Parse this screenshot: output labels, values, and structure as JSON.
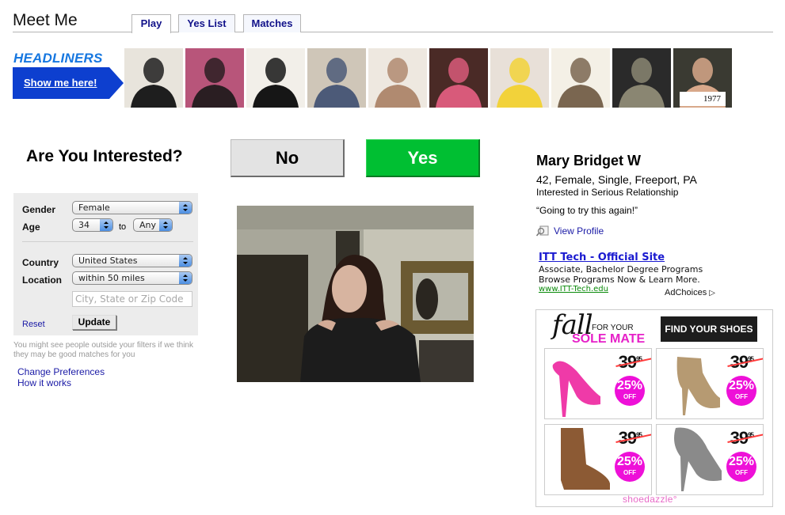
{
  "header": {
    "title": "Meet Me",
    "tabs": [
      {
        "label": "Play",
        "active": true
      },
      {
        "label": "Yes List",
        "active": false
      },
      {
        "label": "Matches",
        "active": false
      }
    ]
  },
  "headliners": {
    "title": "HEADLINERS",
    "button_label": "Show me here!",
    "thumbnails": [
      {
        "name": "headliner-1",
        "colors": [
          "#e8e4dc",
          "#1e1e1e"
        ]
      },
      {
        "name": "headliner-2",
        "colors": [
          "#b8557a",
          "#2a1e22"
        ]
      },
      {
        "name": "headliner-3",
        "colors": [
          "#f2efe9",
          "#161616"
        ]
      },
      {
        "name": "headliner-4",
        "colors": [
          "#cfc6b8",
          "#4c5a78"
        ]
      },
      {
        "name": "headliner-5",
        "colors": [
          "#eee8e0",
          "#b08a70"
        ]
      },
      {
        "name": "headliner-6",
        "colors": [
          "#4a2a26",
          "#d85a7a"
        ]
      },
      {
        "name": "headliner-7",
        "colors": [
          "#e8e0d8",
          "#f2d23a"
        ]
      },
      {
        "name": "headliner-8",
        "colors": [
          "#f4f0e6",
          "#7a6650"
        ]
      },
      {
        "name": "headliner-9",
        "colors": [
          "#2a2a2a",
          "#8a8672"
        ]
      },
      {
        "name": "headliner-10",
        "colors": [
          "#3a3a32",
          "#d8a88a"
        ],
        "caption": "1977"
      }
    ]
  },
  "filters": {
    "heading": "Are You Interested?",
    "gender_label": "Gender",
    "gender_value": "Female",
    "age_label": "Age",
    "age_min": "34",
    "age_to": "to",
    "age_max": "Any",
    "country_label": "Country",
    "country_value": "United States",
    "location_label": "Location",
    "location_value": "within 50 miles",
    "zip_placeholder": "City, State or Zip Code",
    "reset_label": "Reset",
    "update_label": "Update",
    "note": "You might see people outside your filters if we think they may be good matches for you",
    "links": [
      "Change Preferences",
      "How it works"
    ]
  },
  "actions": {
    "no_label": "No",
    "yes_label": "Yes"
  },
  "profile": {
    "name": "Mary Bridget W",
    "details": "42, Female, Single, Freeport, PA",
    "interest": "Interested in Serious Relationship",
    "quote": "“Going to try this again!”",
    "view_profile": "View Profile"
  },
  "text_ad": {
    "title": "ITT Tech - Official Site",
    "line1": "Associate, Bachelor Degree Programs",
    "line2": "Browse Programs Now & Learn More.",
    "url": "www.ITT-Tech.edu",
    "adchoices": "AdChoices"
  },
  "banner_ad": {
    "fall": "fall",
    "for_your": "FOR YOUR",
    "sole_mate": "SOLE MATE",
    "cta": "FIND YOUR SHOES ▶",
    "brand": "shoedazzle°",
    "products": [
      {
        "name": "pink-pump",
        "price": "39",
        "cents": "95",
        "discount": "25%",
        "off": "OFF",
        "color": "#ef3aa8"
      },
      {
        "name": "tan-fringe-bootie",
        "price": "39",
        "cents": "95",
        "discount": "25%",
        "off": "OFF",
        "color": "#b69a72"
      },
      {
        "name": "brown-boot",
        "price": "39",
        "cents": "95",
        "discount": "25%",
        "off": "OFF",
        "color": "#8c5a34"
      },
      {
        "name": "gray-buckle-bootie",
        "price": "39",
        "cents": "95",
        "discount": "25%",
        "off": "OFF",
        "color": "#8a8a8a"
      }
    ]
  }
}
